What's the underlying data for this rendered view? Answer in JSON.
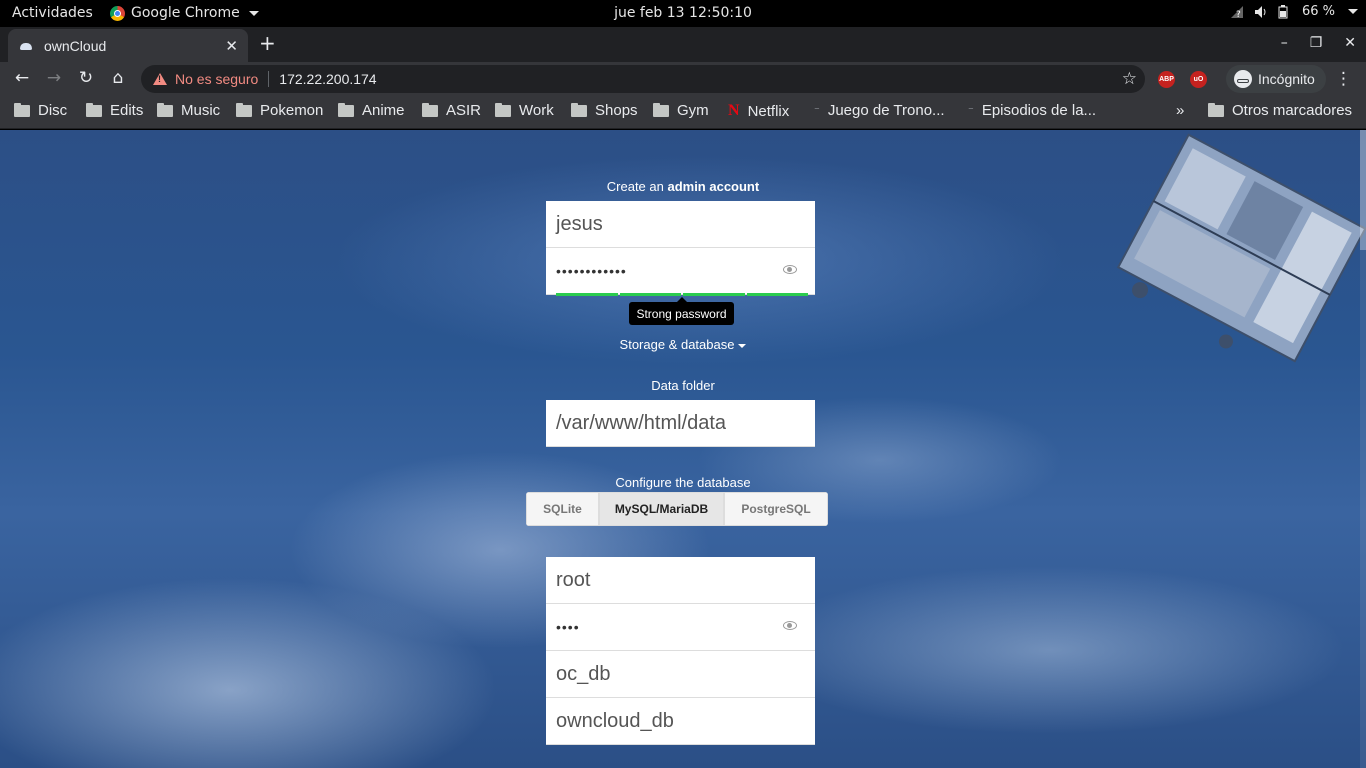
{
  "system": {
    "activities": "Actividades",
    "app_name": "Google Chrome",
    "clock": "jue feb 13  12:50:10",
    "battery": "66 %"
  },
  "browser": {
    "tab_title": "ownCloud",
    "security_label": "No es seguro",
    "url": "172.22.200.174",
    "profile_label": "Incógnito",
    "extensions": [
      "ABP",
      "uO"
    ],
    "bookmarks": [
      "Disc",
      "Edits",
      "Music",
      "Pokemon",
      "Anime",
      "ASIR",
      "Work",
      "Shops",
      "Gym",
      "Netflix",
      "Juego de Trono...",
      "Episodios de la..."
    ],
    "overflow_label": "»",
    "other_bookmarks": "Otros marcadores"
  },
  "setup": {
    "admin_prefix": "Create an ",
    "admin_bold": "admin account",
    "username": "jesus",
    "password_mask": "••••••••••••",
    "strength_tooltip": "Strong password",
    "storage_toggle": "Storage & database",
    "data_folder_label": "Data folder",
    "data_folder_value": "/var/www/html/data",
    "configure_db_label": "Configure the database",
    "db_options": [
      "SQLite",
      "MySQL/MariaDB",
      "PostgreSQL"
    ],
    "db_selected": "MySQL/MariaDB",
    "db_user": "root",
    "db_password_mask": "••••",
    "db_name": "oc_db",
    "db_host": "owncloud_db"
  },
  "colors": {
    "strength_bar": "#2bcc4f",
    "warning": "#f28b82"
  }
}
